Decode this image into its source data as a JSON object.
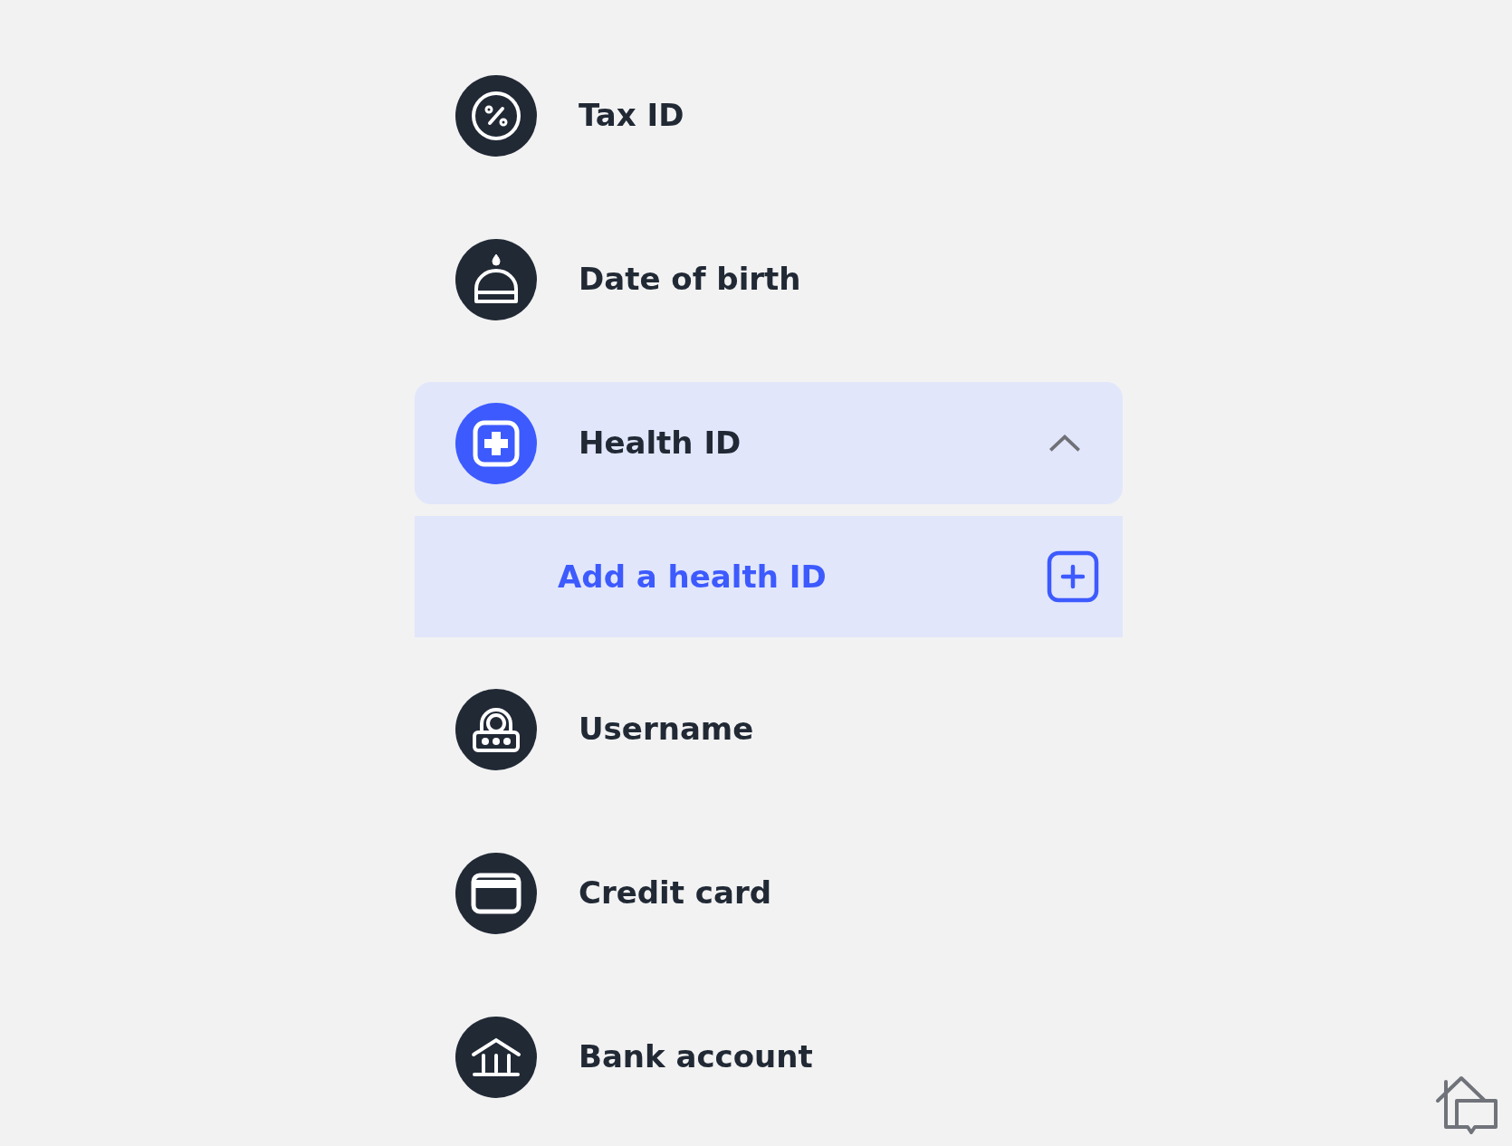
{
  "items": [
    {
      "label": "Tax ID"
    },
    {
      "label": "Date of birth"
    },
    {
      "label": "Health ID",
      "expanded": true,
      "children": [
        {
          "label": "Add a health ID"
        }
      ]
    },
    {
      "label": "Username"
    },
    {
      "label": "Credit card"
    },
    {
      "label": "Bank account"
    }
  ]
}
